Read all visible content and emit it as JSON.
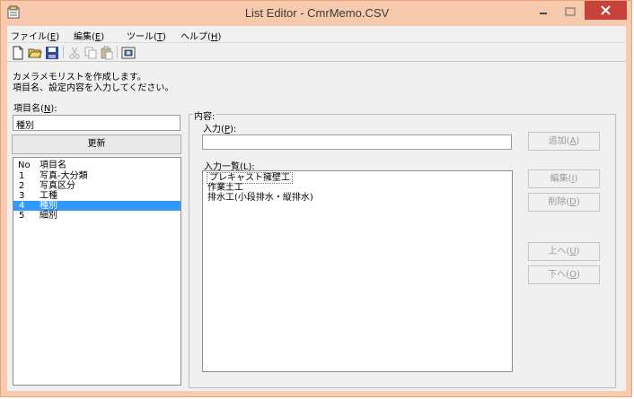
{
  "window": {
    "title": "List Editor - CmrMemo.CSV"
  },
  "menu": [
    {
      "label": "ファイル(",
      "key": "E",
      "suffix": ")"
    },
    {
      "label": "編集(",
      "key": "E",
      "suffix": ")"
    },
    {
      "label": "ツール(",
      "key": "T",
      "suffix": ")"
    },
    {
      "label": "ヘルプ(",
      "key": "H",
      "suffix": ")"
    }
  ],
  "toolbar": {
    "icons": [
      "new-file-icon",
      "open-folder-icon",
      "save-icon",
      "cut-icon",
      "copy-icon",
      "paste-icon",
      "camera-memo-icon"
    ]
  },
  "description": {
    "line1": "カメラメモリストを作成します。",
    "line2": "項目名、設定内容を入力してください。"
  },
  "item_name": {
    "label": "項目名(",
    "key": "N",
    "suffix": "):",
    "value": "種別"
  },
  "update_button": {
    "label": "更新"
  },
  "item_list": {
    "headers": [
      "No",
      "項目名"
    ],
    "rows": [
      {
        "no": "1",
        "name": "写真-大分類",
        "selected": false
      },
      {
        "no": "2",
        "name": "写真区分",
        "selected": false
      },
      {
        "no": "3",
        "name": "工種",
        "selected": false
      },
      {
        "no": "4",
        "name": "種別",
        "selected": true
      },
      {
        "no": "5",
        "name": "細別",
        "selected": false
      }
    ]
  },
  "content_group": {
    "label": "内容:"
  },
  "input_field": {
    "label": "入力(",
    "key": "P",
    "suffix": "):",
    "value": ""
  },
  "input_list": {
    "label": "入力一覧(",
    "key": "L",
    "suffix": "):",
    "items": [
      "プレキャスト擁壁工",
      "作業土工",
      "排水工(小段排水・縦排水)"
    ]
  },
  "buttons": {
    "add": {
      "label": "追加(",
      "key": "A",
      "suffix": ")"
    },
    "edit": {
      "label": "編集(",
      "key": "I",
      "suffix": ")"
    },
    "delete": {
      "label": "削除(",
      "key": "D",
      "suffix": ")"
    },
    "up": {
      "label": "上へ(",
      "key": "U",
      "suffix": ")"
    },
    "down": {
      "label": "下へ(",
      "key": "O",
      "suffix": ")"
    }
  },
  "colors": {
    "titlebar": "#f7c9ad",
    "close": "#c7423a",
    "selection": "#3399ff"
  }
}
